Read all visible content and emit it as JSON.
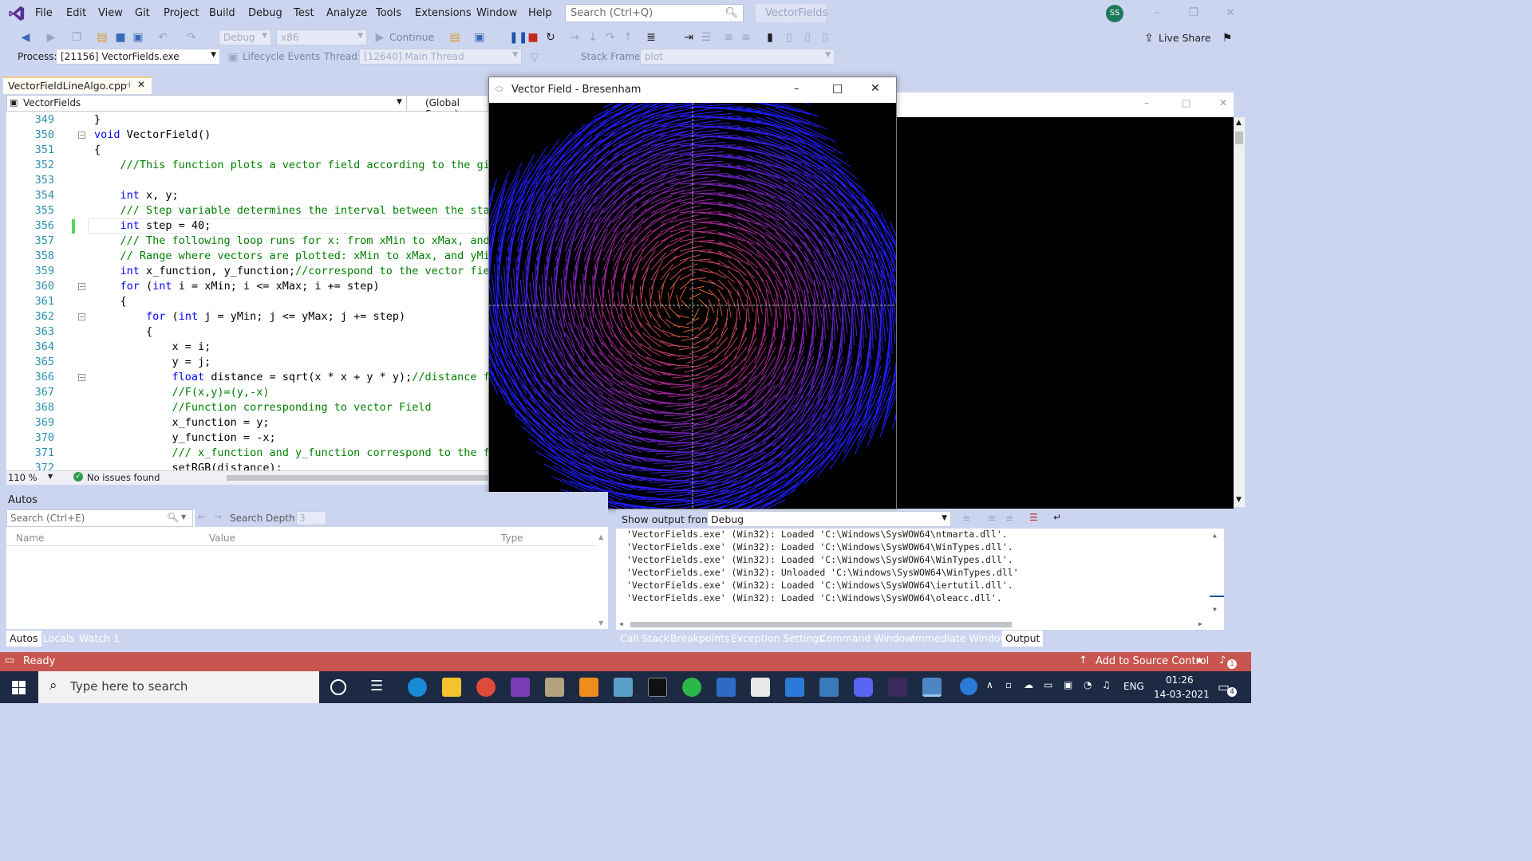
{
  "menubar": {
    "items": [
      "File",
      "Edit",
      "View",
      "Git",
      "Project",
      "Build",
      "Debug",
      "Test",
      "Analyze",
      "Tools",
      "Extensions",
      "Window",
      "Help"
    ],
    "search_placeholder": "Search (Ctrl+Q)",
    "solution_name": "VectorFields",
    "user_initials": "SS"
  },
  "toolbar": {
    "config": "Debug",
    "platform": "x86",
    "continue_label": "Continue",
    "live_share": "Live Share"
  },
  "debugbar": {
    "process_label": "Process:",
    "process_value": "[21156] VectorFields.exe",
    "lifecycle_label": "Lifecycle Events",
    "thread_label": "Thread:",
    "thread_value": "[12640] Main Thread",
    "stack_frame_label": "Stack Frame:",
    "stack_frame_value": "plot"
  },
  "editor": {
    "tab_name": "VectorFieldLineAlgo.cpp",
    "project": "VectorFields",
    "scope": "(Global Scope)",
    "zoom": "110 %",
    "issues": "No issues found",
    "lines": [
      {
        "n": "349",
        "t": "}",
        "c": ""
      },
      {
        "n": "350",
        "t": "void VectorField()",
        "c": "kwfirst"
      },
      {
        "n": "351",
        "t": "{",
        "c": ""
      },
      {
        "n": "352",
        "t": "    ///This function plots a vector field according to the give",
        "c": "cm"
      },
      {
        "n": "353",
        "t": "",
        "c": ""
      },
      {
        "n": "354",
        "t": "    int x, y;",
        "c": "int"
      },
      {
        "n": "355",
        "t": "    /// Step variable determines the interval between the start",
        "c": "cm"
      },
      {
        "n": "356",
        "t": "    int step = 40;",
        "c": "int"
      },
      {
        "n": "357",
        "t": "    /// The following loop runs for x: from xMin to xMax, and f",
        "c": "cm"
      },
      {
        "n": "358",
        "t": "    // Range where vectors are plotted: xMin to xMax, and yMin",
        "c": "cm"
      },
      {
        "n": "359",
        "t": "    int x_function, y_function;//correspond to the vector field",
        "c": "intcm"
      },
      {
        "n": "360",
        "t": "    for (int i = xMin; i <= xMax; i += step)",
        "c": "for"
      },
      {
        "n": "361",
        "t": "    {",
        "c": ""
      },
      {
        "n": "362",
        "t": "        for (int j = yMin; j <= yMax; j += step)",
        "c": "for"
      },
      {
        "n": "363",
        "t": "        {",
        "c": ""
      },
      {
        "n": "364",
        "t": "            x = i;",
        "c": ""
      },
      {
        "n": "365",
        "t": "            y = j;",
        "c": ""
      },
      {
        "n": "366",
        "t": "            float distance = sqrt(x * x + y * y);//distance fro",
        "c": "float"
      },
      {
        "n": "367",
        "t": "            //F(x,y)=(y,-x)",
        "c": "cm"
      },
      {
        "n": "368",
        "t": "            //Function corresponding to vector Field",
        "c": "cm"
      },
      {
        "n": "369",
        "t": "            x_function = y;",
        "c": ""
      },
      {
        "n": "370",
        "t": "            y_function = -x;",
        "c": ""
      },
      {
        "n": "371",
        "t": "            /// x_function and y_function correspond to the fun",
        "c": "cm"
      },
      {
        "n": "372",
        "t": "            setRGB(distance);",
        "c": ""
      }
    ]
  },
  "bresenham": {
    "title": "Vector Field - Bresenham"
  },
  "autos": {
    "title": "Autos",
    "search_placeholder": "Search (Ctrl+E)",
    "search_depth_label": "Search Depth:",
    "search_depth": "3",
    "col_name": "Name",
    "col_value": "Value",
    "col_type": "Type",
    "tabs": [
      "Autos",
      "Locals",
      "Watch 1"
    ]
  },
  "output": {
    "show_from_label": "Show output from:",
    "show_from_value": "Debug",
    "lines": [
      "'VectorFields.exe' (Win32): Loaded 'C:\\Windows\\SysWOW64\\ntmarta.dll'.",
      "'VectorFields.exe' (Win32): Loaded 'C:\\Windows\\SysWOW64\\WinTypes.dll'.",
      "'VectorFields.exe' (Win32): Loaded 'C:\\Windows\\SysWOW64\\WinTypes.dll'.",
      "'VectorFields.exe' (Win32): Unloaded 'C:\\Windows\\SysWOW64\\WinTypes.dll'",
      "'VectorFields.exe' (Win32): Loaded 'C:\\Windows\\SysWOW64\\iertutil.dll'.",
      "'VectorFields.exe' (Win32): Loaded 'C:\\Windows\\SysWOW64\\oleacc.dll'."
    ],
    "tabs": [
      "Call Stack",
      "Breakpoints",
      "Exception Settings",
      "Command Window",
      "Immediate Window",
      "Output"
    ]
  },
  "status": {
    "ready": "Ready",
    "source_control": "Add to Source Control",
    "notifications": "1"
  },
  "taskbar": {
    "search_placeholder": "Type here to search",
    "language": "ENG",
    "time": "01:26",
    "date": "14-03-2021",
    "notification_count": "4"
  },
  "colors": {
    "statusbar": "#c8554f",
    "accent": "#007acc",
    "field_inner": "#e07020",
    "field_mid": "#a02080",
    "field_outer": "#2020ff"
  }
}
